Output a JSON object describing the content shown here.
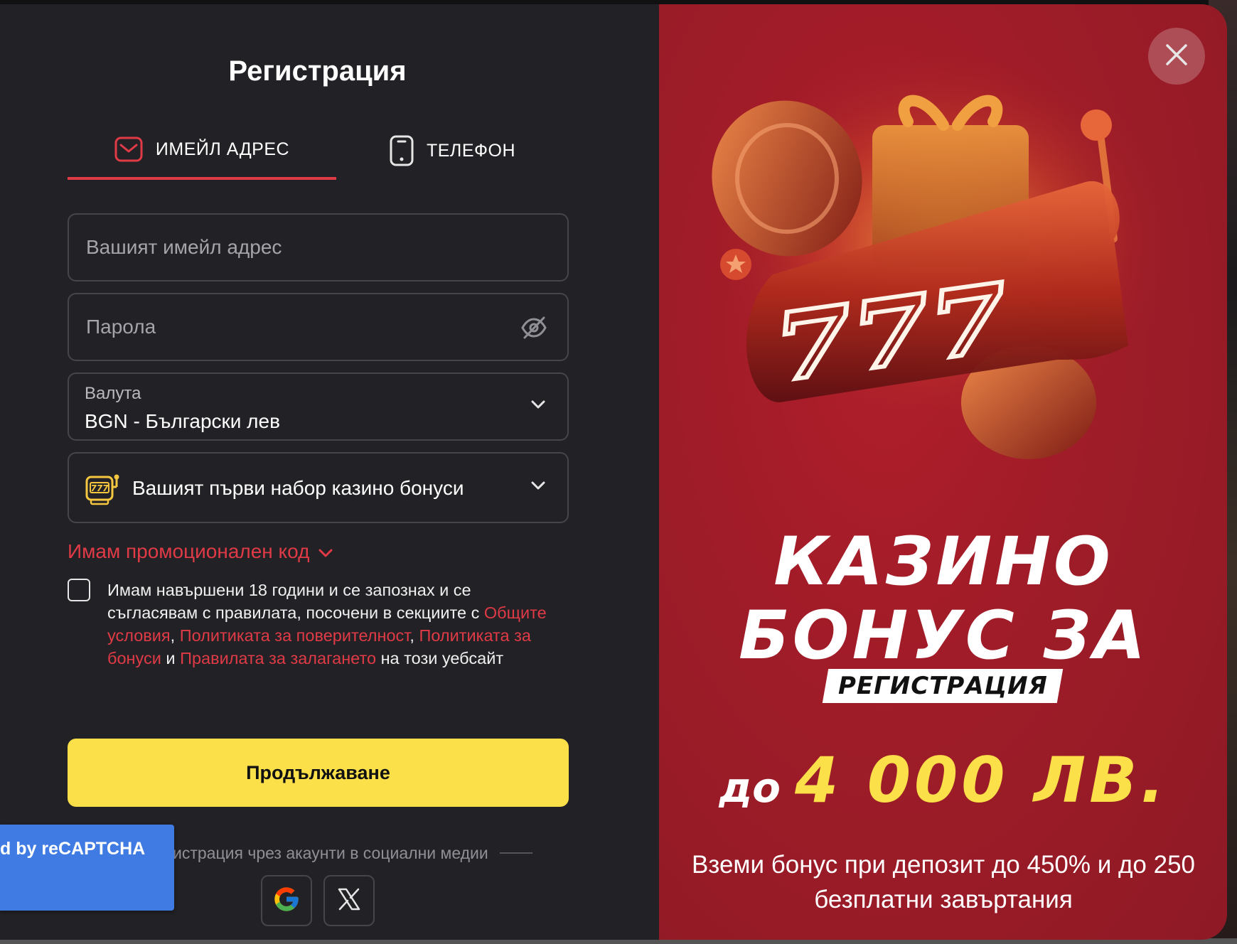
{
  "registration": {
    "title": "Регистрация",
    "tabs": [
      {
        "label": "ИМЕЙЛ АДРЕС",
        "icon": "envelope-icon",
        "active": true
      },
      {
        "label": "ТЕЛЕФОН",
        "icon": "phone-icon",
        "active": false
      }
    ],
    "email": {
      "placeholder": "Вашият имейл адрес",
      "value": ""
    },
    "password": {
      "placeholder": "Парола",
      "value": "",
      "toggle_icon": "eye-off-icon"
    },
    "currency": {
      "label": "Валута",
      "value": "BGN - Български лев"
    },
    "bonus": {
      "label": "Вашият първи набор казино бонуси",
      "icon": "slot-machine-icon"
    },
    "promo_link": "Имам промоционален код",
    "terms": {
      "checked": false,
      "text_1": "Имам навършени 18 години и се запознах и се съгласявам с правилата, посочени в секциите с",
      "link_1": "Общите условия",
      "sep_1": ",",
      "link_2": "Политиката за поверителност",
      "sep_2": ",",
      "link_3": "Политиката за бонуси",
      "conj": "и",
      "link_4": "Правилата за залагането",
      "text_2": "на този уебсайт"
    },
    "continue_label": "Продължаване",
    "social_text": "истрация чрез акаунти в социални медии",
    "social_buttons": [
      "google-icon",
      "x-icon"
    ]
  },
  "recaptcha": {
    "label": "d by reCAPTCHA"
  },
  "promo": {
    "close_icon": "close-icon",
    "headline_1": "КАЗИНО",
    "headline_2": "БОНУС ЗА",
    "badge": "РЕГИСТРАЦИЯ",
    "amount_prefix": "до",
    "amount_value": "4 000 ЛВ.",
    "subtext": "Вземи бонус при депозит до 450% и до 250 безплатни завъртания",
    "art_text": "777",
    "art_description_icon": "slot-machine-gift-coins-art"
  },
  "colors": {
    "accent_red": "#e03a46",
    "cta_yellow": "#fbe04a",
    "panel_dark": "#222226",
    "promo_red": "#a31d29"
  }
}
